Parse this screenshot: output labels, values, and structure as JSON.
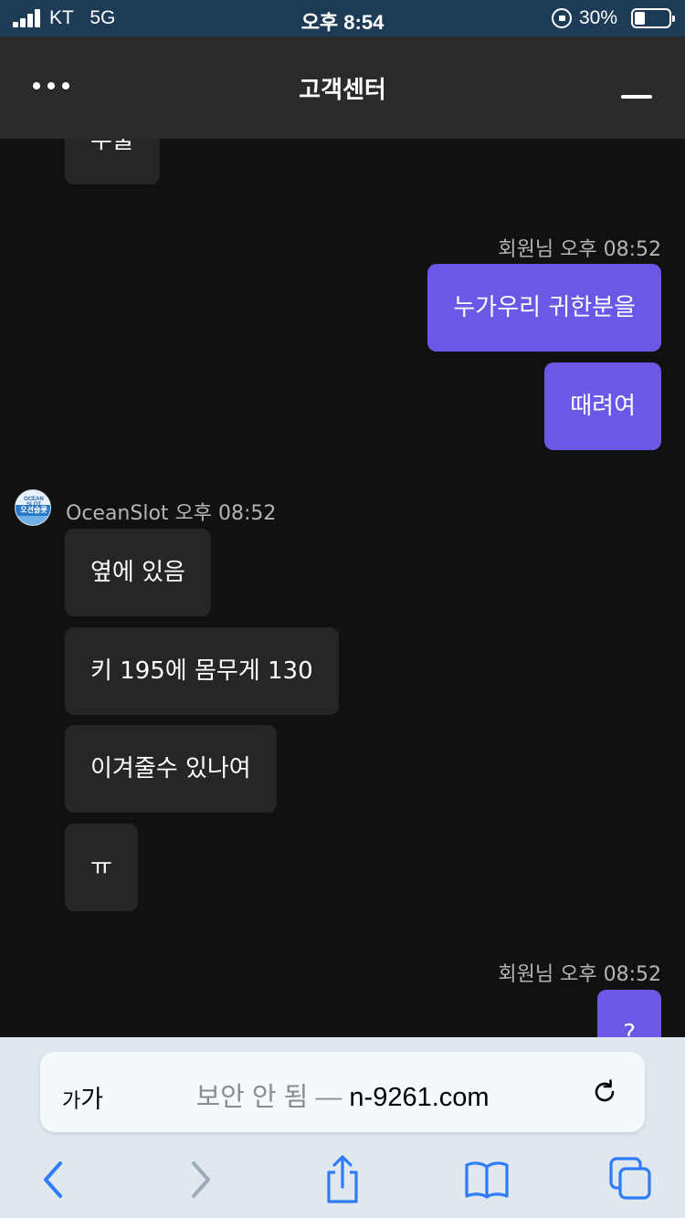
{
  "status_bar": {
    "carrier": "KT",
    "network": "5G",
    "time": "오후 8:54",
    "battery_percent": "30%",
    "battery_level": 0.3
  },
  "header": {
    "title": "고객센터",
    "menu_icon": "more-dots-icon",
    "minimize_icon": "minimize-icon"
  },
  "chat": {
    "messages": [
      {
        "sender": "bot",
        "text": "우울"
      },
      {
        "sender": "user",
        "meta": "회원님 오후 08:52"
      },
      {
        "sender": "user",
        "text": "누가우리 귀한분을"
      },
      {
        "sender": "user",
        "text": "때려여"
      },
      {
        "sender": "bot",
        "meta": "OceanSlot 오후 08:52"
      },
      {
        "sender": "bot",
        "text": "옆에 있음"
      },
      {
        "sender": "bot",
        "text": "키 195에 몸무게 130"
      },
      {
        "sender": "bot",
        "text": "이겨줄수 있나여"
      },
      {
        "sender": "bot",
        "text": "ㅠ"
      },
      {
        "sender": "user",
        "meta": "회원님 오후 08:52"
      },
      {
        "sender": "user",
        "text": "?"
      }
    ],
    "avatar": {
      "top_text": "OCEAN SLOT",
      "band_text": "오션슬롯"
    }
  },
  "browser": {
    "text_size_small": "가",
    "text_size_large": "가",
    "insecure_label": "보안 안 됨 —",
    "domain": "n-9261.com",
    "accent_color": "#2f7cf6",
    "icons": [
      "back-icon",
      "forward-icon",
      "share-icon",
      "bookmarks-icon",
      "tabs-icon",
      "reload-icon"
    ]
  }
}
